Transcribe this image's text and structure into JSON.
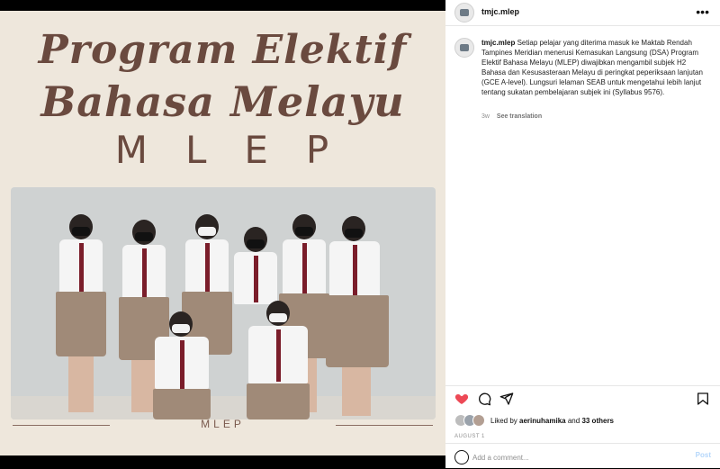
{
  "post": {
    "username": "tmjc.mlep",
    "poster": {
      "title_line1": "Program Elektif",
      "title_line2": "Bahasa Melayu",
      "title_line3": "MLEP",
      "footer": "MLEP"
    },
    "caption": "Setiap pelajar yang diterima masuk ke Maktab Rendah Tampines Meridian menerusi Kemasukan Langsung (DSA) Program Elektif Bahasa Melayu (MLEP) diwajibkan mengambil subjek H2 Bahasa dan Kesusasteraan Melayu di peringkat peperiksaan lanjutan (GCE A-level). Lungsuri lelaman SEAB untuk mengetahui lebih lanjut tentang sukatan pembelajaran subjek ini (Syllabus 9576).",
    "time_ago": "3w",
    "see_translation": "See translation",
    "likes_prefix": "Liked by",
    "likes_user": "aerinuhamika",
    "likes_and": "and",
    "likes_others": "33 others",
    "date": "AUGUST 1"
  },
  "comment": {
    "placeholder": "Add a comment...",
    "post_label": "Post"
  },
  "icons": {
    "heart": "heart-icon",
    "comment": "comment-icon",
    "share": "share-icon",
    "save": "bookmark-icon",
    "more": "more-icon",
    "emoji": "emoji-icon"
  },
  "colors": {
    "heart": "#ed4956",
    "poster_text": "#6a4a3f",
    "post_button": "#b5d7fb"
  }
}
